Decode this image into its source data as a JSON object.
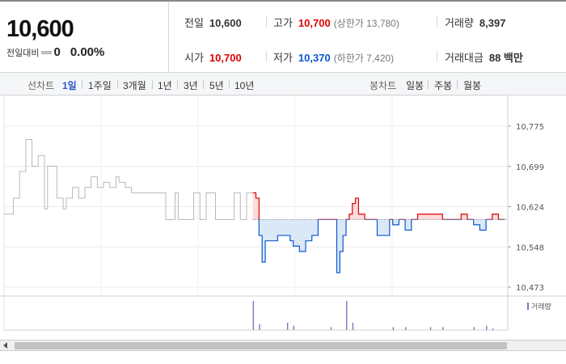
{
  "quote": {
    "current_price": "10,600",
    "change_label": "전일대비",
    "change_value": "0",
    "change_rate": "0.00%"
  },
  "stats": {
    "prev_close_label": "전일",
    "prev_close": "10,600",
    "high_label": "고가",
    "high": "10,700",
    "upper_limit": "(상한가 13,780)",
    "volume_label": "거래량",
    "volume": "8,397",
    "open_label": "시가",
    "open": "10,700",
    "low_label": "저가",
    "low": "10,370",
    "lower_limit": "(하한가 7,420)",
    "amount_label": "거래대금",
    "amount": "88 백만"
  },
  "range_bar": {
    "line_title": "선차트",
    "line_options": [
      "1일",
      "1주일",
      "3개월",
      "1년",
      "3년",
      "5년",
      "10년"
    ],
    "active_index": 0,
    "candle_title": "봉차트",
    "candle_options": [
      "일봉",
      "주봉",
      "월봉"
    ]
  },
  "colors": {
    "up": "#e00000",
    "down": "#0a58d0",
    "flat": "#b8b8b8"
  },
  "chart_data": {
    "type": "line",
    "y_ticks": [
      "10,775",
      "10,699",
      "10,624",
      "10,548",
      "10,473"
    ],
    "ylim": [
      10473,
      10775
    ],
    "baseline": 10600,
    "volume_label": "거래량",
    "segments": [
      {
        "kind": "prev",
        "color": "#b8b8b8",
        "x": [
          0,
          3,
          5,
          7,
          9,
          11,
          13,
          14,
          17,
          19,
          20,
          22,
          24,
          26,
          28,
          30,
          32,
          34,
          36,
          37,
          39,
          41,
          44,
          46,
          50,
          52,
          55,
          56,
          58,
          61,
          63,
          65,
          68,
          70,
          72,
          74,
          76,
          78,
          80
        ],
        "y": [
          10610,
          10640,
          10690,
          10750,
          10700,
          10720,
          10620,
          10700,
          10640,
          10620,
          10640,
          10660,
          10640,
          10660,
          10680,
          10660,
          10670,
          10660,
          10680,
          10670,
          10660,
          10650,
          10650,
          10650,
          10650,
          10600,
          10650,
          10600,
          10600,
          10650,
          10600,
          10650,
          10600,
          10600,
          10600,
          10650,
          10600,
          10650,
          10650
        ]
      },
      {
        "kind": "today",
        "color": "#0a58d0",
        "x": [
          80,
          81,
          82,
          83,
          84,
          86,
          88,
          90,
          92,
          93,
          95,
          97,
          99,
          101,
          103,
          105,
          106,
          107,
          108,
          109,
          110,
          111,
          112,
          113,
          114,
          116,
          118,
          120,
          121,
          122,
          123,
          124,
          125,
          127,
          129,
          131,
          133,
          135,
          137,
          139,
          141,
          143,
          145,
          147,
          149,
          151,
          153,
          155,
          157,
          159,
          161
        ],
        "y": [
          10650,
          10640,
          10570,
          10520,
          10560,
          10560,
          10570,
          10570,
          10560,
          10550,
          10540,
          10560,
          10570,
          10600,
          10600,
          10600,
          10600,
          10500,
          10540,
          10570,
          10600,
          10610,
          10630,
          10640,
          10610,
          10600,
          10600,
          10570,
          10570,
          10570,
          10570,
          10600,
          10590,
          10600,
          10580,
          10600,
          10610,
          10610,
          10610,
          10610,
          10600,
          10600,
          10600,
          10610,
          10600,
          10590,
          10580,
          10600,
          10610,
          10600,
          10600
        ]
      }
    ],
    "volume": [
      {
        "x": 80,
        "v": 1.0
      },
      {
        "x": 82,
        "v": 0.2
      },
      {
        "x": 91,
        "v": 0.25
      },
      {
        "x": 93,
        "v": 0.15
      },
      {
        "x": 105,
        "v": 0.1
      },
      {
        "x": 110,
        "v": 1.0
      },
      {
        "x": 112,
        "v": 0.25
      },
      {
        "x": 125,
        "v": 0.1
      },
      {
        "x": 129,
        "v": 0.1
      },
      {
        "x": 137,
        "v": 0.1
      },
      {
        "x": 141,
        "v": 0.1
      },
      {
        "x": 151,
        "v": 0.1
      },
      {
        "x": 155,
        "v": 0.15
      },
      {
        "x": 157,
        "v": 0.05
      }
    ]
  }
}
